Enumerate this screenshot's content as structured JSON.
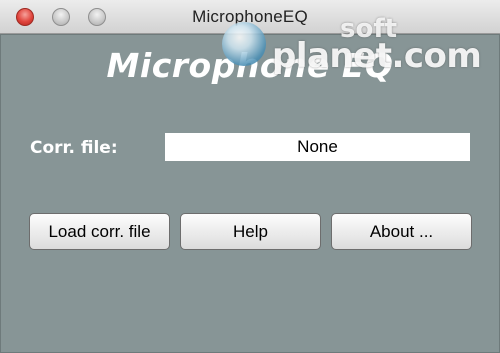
{
  "window": {
    "title": "MicrophoneEQ"
  },
  "main": {
    "heading": "Microphone EQ",
    "corr_file_label": "Corr. file:",
    "corr_file_value": "None"
  },
  "buttons": {
    "load": "Load corr. file",
    "help": "Help",
    "about": "About ..."
  },
  "watermark": {
    "soft": "soft",
    "planet": "planet.com"
  },
  "colors": {
    "content_bg": "#879596",
    "close_button": "#e0443c",
    "heading_text": "#ffffff"
  }
}
